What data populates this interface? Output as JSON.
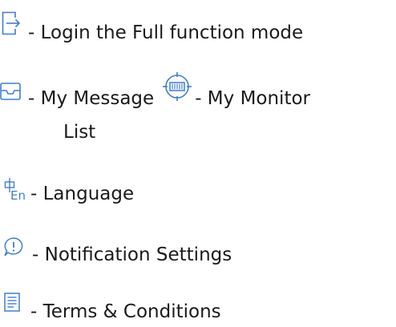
{
  "legend": {
    "items": [
      {
        "icon": "login-icon",
        "label": "- Login the Full function mode"
      },
      {
        "icon": "inbox-icon",
        "label": "- My Message "
      },
      {
        "icon": "monitor-icon",
        "label": "- My Monitor"
      },
      {
        "label_continued": "List"
      },
      {
        "icon": "language-icon",
        "label": "- Language"
      },
      {
        "icon": "notification-icon",
        "label": "- Notification Settings"
      },
      {
        "icon": "document-icon",
        "label": "- Terms & Conditions"
      }
    ]
  },
  "colors": {
    "icon_blue": "#3f7fd0",
    "text": "#1a1a1a"
  }
}
